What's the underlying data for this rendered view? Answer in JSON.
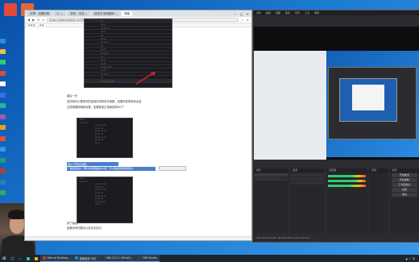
{
  "colors": {
    "desktop": "#1b78d0",
    "obs_dark": "#2b2b30",
    "highlight": "#4a7fd0"
  },
  "browser": {
    "tabs": [
      "分享 · 设置标签",
      "4. …",
      "资讯 · 天天…",
      "检查方法和具体…",
      "博客"
    ],
    "address": "https://www.bilibili.com/read/cv…",
    "nav_icons": [
      "back-icon",
      "forward-icon",
      "refresh-icon",
      "home-icon"
    ],
    "window_controls": [
      "—",
      "□",
      "✕"
    ],
    "article": {
      "step_label": "最后一步",
      "para1": "这样就可以看到你的连接情况和丢失帧数，如果你发现丢帧太高",
      "para2": "注意看看网络和设置，如果数量正常就说明OK了",
      "highlight1": "如以下的对话框，",
      "highlight2": "一般丢帧是0，那么你的网络是OK的，可以继续使用推流软件",
      "footer1": "到了最后，",
      "footer2": "如果你有问题可以在评论区问"
    }
  },
  "obs": {
    "menus": [
      "文件",
      "编辑",
      "视图",
      "配置",
      "场景",
      "工具",
      "帮助"
    ],
    "docks": [
      "场景",
      "来源",
      "混音器",
      "转场",
      "控件"
    ],
    "controls": [
      "开始推流",
      "开始录制",
      "工作室模式",
      "设置",
      "退出"
    ],
    "status": "LIVE: 00:00:00  REC: 00:00:00  CPU: 2.5%, 30.00 fps"
  },
  "taskbar": {
    "items": [
      "Path of Building...",
      "直播回放-OBS",
      "OBS 23.2.1 (64-bit)...",
      "OBS Studio"
    ],
    "clock_time": "",
    "tray": "中"
  }
}
